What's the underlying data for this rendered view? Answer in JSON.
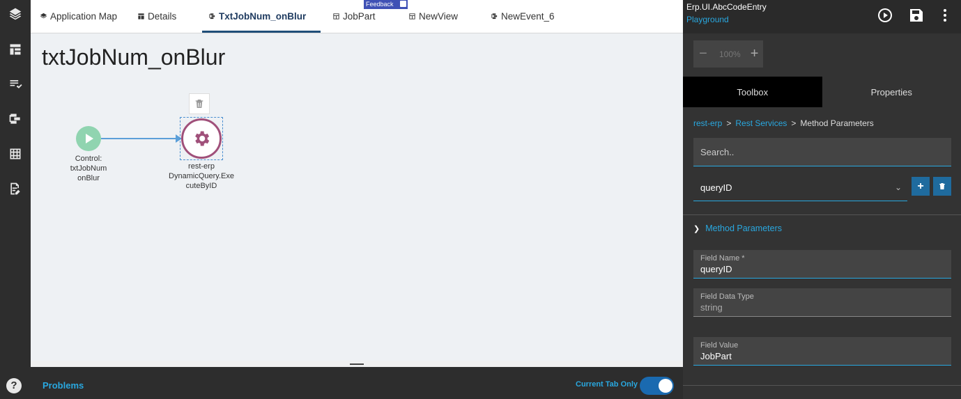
{
  "tabs": [
    {
      "label": "Application Map",
      "icon": "layers-icon"
    },
    {
      "label": "Details",
      "icon": "table-icon"
    },
    {
      "label": "TxtJobNum_onBlur",
      "icon": "event-icon"
    },
    {
      "label": "JobPart",
      "icon": "view-icon"
    },
    {
      "label": "NewView",
      "icon": "view-icon"
    },
    {
      "label": "NewEvent_6",
      "icon": "event-icon"
    }
  ],
  "feedback": {
    "label": "Feedback"
  },
  "canvas": {
    "title": "txtJobNum_onBlur",
    "start_node": {
      "line1": "Control:",
      "line2": "txtJobNum",
      "line3": "onBlur"
    },
    "action_node": {
      "line1": "rest-erp",
      "line2": "DynamicQuery.Exe",
      "line3": "cuteByID"
    }
  },
  "bottom": {
    "problems": "Problems",
    "current_tab_only": "Current Tab Only",
    "toggle_on": true
  },
  "right": {
    "title": "Erp.UI.AbcCodeEntry",
    "subtitle": "Playground",
    "zoom": {
      "minus": "−",
      "value": "100%",
      "plus": "+"
    },
    "panel_tabs": [
      {
        "label": "Toolbox",
        "active": true
      },
      {
        "label": "Properties",
        "active": false
      }
    ],
    "breadcrumb": {
      "item1": "rest-erp",
      "item2": "Rest Services",
      "item3": "Method Parameters",
      "sep": ">"
    },
    "search_placeholder": "Search..",
    "select_value": "queryID",
    "section_title": "Method Parameters",
    "fields": [
      {
        "label": "Field Name *",
        "value": "queryID"
      },
      {
        "label": "Field Data Type",
        "value": "string"
      },
      {
        "label": "Field Value",
        "value": "JobPart"
      }
    ]
  },
  "colors": {
    "accent": "#29a8e0",
    "action_node": "#a0507a",
    "start_node": "#90d4b0",
    "toggle": "#1a6ab0"
  }
}
